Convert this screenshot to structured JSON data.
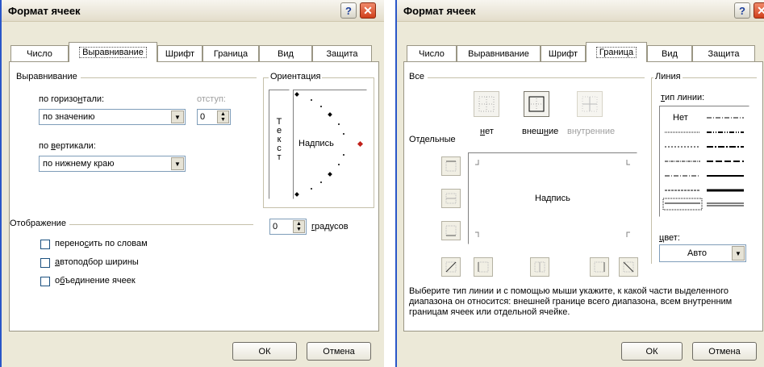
{
  "left": {
    "title": "Формат ячеек",
    "help": "?",
    "close": "✕",
    "tabs": [
      "Число",
      "Выравнивание",
      "Шрифт",
      "Граница",
      "Вид",
      "Защита"
    ],
    "alignment": {
      "group": "Выравнивание",
      "horizontal_label_pre": "по горизо",
      "horizontal_label_u": "н",
      "horizontal_label_post": "тали:",
      "horizontal_value": "по значению",
      "indent_label": "отступ:",
      "indent_value": "0",
      "vertical_label_pre": "по ",
      "vertical_label_u": "в",
      "vertical_label_post": "ертикали:",
      "vertical_value": "по нижнему краю"
    },
    "orientation": {
      "group": "Ориентация",
      "vertical_text": [
        "Т",
        "е",
        "к",
        "с",
        "т"
      ],
      "caption": "Надпись",
      "degrees_value": "0",
      "degrees_u": "г",
      "degrees_post": "радусов"
    },
    "display": {
      "group": "Отображение",
      "wrap_pre": "перено",
      "wrap_u": "с",
      "wrap_post": "ить по словам",
      "autofit_u": "а",
      "autofit_post": "втоподбор ширины",
      "merge_pre": "о",
      "merge_u": "б",
      "merge_post": "ъединение ячеек"
    },
    "ok": "ОК",
    "cancel": "Отмена"
  },
  "right": {
    "title": "Формат ячеек",
    "help": "?",
    "tabs": [
      "Число",
      "Выравнивание",
      "Шрифт",
      "Граница",
      "Вид",
      "Защита"
    ],
    "all_group": "Все",
    "presets": {
      "none_pre": "",
      "none_u": "н",
      "none_post": "ет",
      "outer_pre": "внеш",
      "outer_u": "н",
      "outer_post": "ие",
      "inner": "внутренние"
    },
    "separate_label": "Отдельные",
    "preview_caption": "Надпись",
    "line": {
      "group": "Линия",
      "type_pre": "",
      "type_u": "т",
      "type_post": "ип линии:",
      "none": "Нет",
      "color_pre": "",
      "color_u": "ц",
      "color_post": "вет:",
      "color_value": "Авто"
    },
    "hint": "Выберите тип линии и с помощью мыши укажите, к какой части выделенного диапазона он относится: внешней границе всего диапазона, всем внутренним границам ячеек или отдельной ячейке.",
    "ok": "ОК",
    "cancel": "Отмена"
  }
}
